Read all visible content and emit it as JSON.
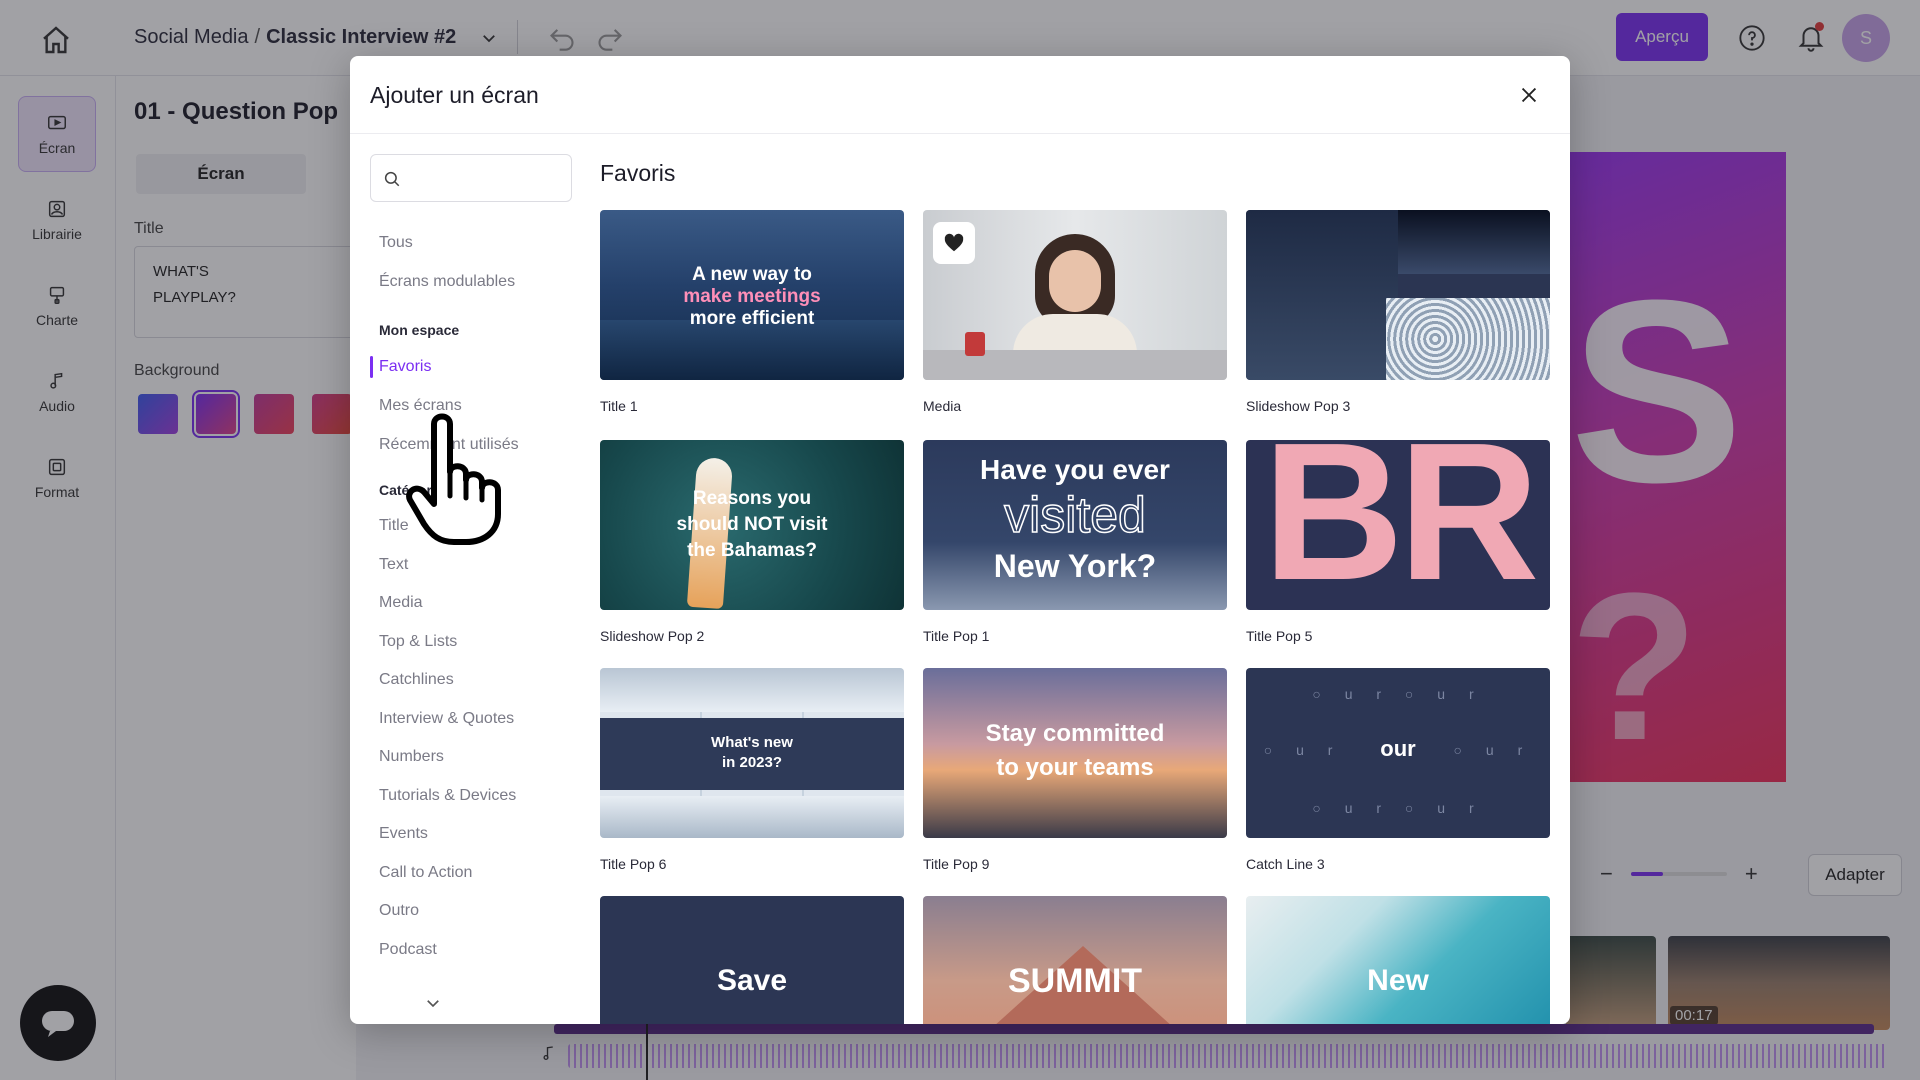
{
  "topbar": {
    "project": "Social Media",
    "separator": "/",
    "video": "Classic Interview #2",
    "preview_label": "Aperçu",
    "avatar_letter": "S"
  },
  "rail": {
    "items": [
      {
        "label": "Écran",
        "icon": "screen-icon"
      },
      {
        "label": "Librairie",
        "icon": "library-icon"
      },
      {
        "label": "Charte",
        "icon": "brand-icon"
      },
      {
        "label": "Audio",
        "icon": "audio-icon"
      },
      {
        "label": "Format",
        "icon": "format-icon"
      }
    ]
  },
  "editor": {
    "title": "01 - Question Pop",
    "tab": "Écran",
    "title_label": "Title",
    "title_value": "WHAT'S\nPLAYPLAY?",
    "background_label": "Background",
    "swatches": [
      "#5b4fe0",
      "#8a3fd8",
      "#d0407a",
      "#e0406a"
    ]
  },
  "canvas": {
    "letter": "S",
    "question": "?"
  },
  "zoom": {
    "minus": "−",
    "plus": "+",
    "level": 0.34,
    "fit_label": "Adapter"
  },
  "timeline": {
    "clip_time": "00:17"
  },
  "modal": {
    "title": "Ajouter un écran",
    "search_placeholder": "",
    "nav": {
      "top": [
        "Tous",
        "Écrans modulables"
      ],
      "my_space_heading": "Mon espace",
      "my_space": [
        "Favoris",
        "Mes écrans",
        "Récemment utilisés"
      ],
      "active": "Favoris",
      "categories_heading": "Catégories",
      "categories": [
        "Title",
        "Text",
        "Media",
        "Top & Lists",
        "Catchlines",
        "Interview & Quotes",
        "Numbers",
        "Tutorials & Devices",
        "Events",
        "Call to Action",
        "Outro",
        "Podcast"
      ]
    },
    "section_title": "Favoris",
    "cards": [
      {
        "label": "Title 1",
        "text_l1": "A new way to",
        "text_l2": "make meetings",
        "text_l3": "more efficient"
      },
      {
        "label": "Media"
      },
      {
        "label": "Slideshow Pop 3"
      },
      {
        "label": "Slideshow Pop 2",
        "text_l1": "Reasons you",
        "text_l2": "should NOT visit",
        "text_l3": "the Bahamas?"
      },
      {
        "label": "Title Pop 1",
        "text_l1": "Have you ever",
        "text_l2": "visited",
        "text_l3": "New York?"
      },
      {
        "label": "Title Pop 5",
        "text_l1": "BR"
      },
      {
        "label": "Title Pop 6",
        "text_l1": "What's new",
        "text_l2": "in 2023?"
      },
      {
        "label": "Title Pop 9",
        "text_l1": "Stay committed",
        "text_l2": "to your teams"
      },
      {
        "label": "Catch Line 3",
        "text_l1": "our"
      },
      {
        "label": "",
        "text_l1": "Save"
      },
      {
        "label": "",
        "text_l1": "SUMMIT"
      },
      {
        "label": "",
        "text_l1": "New"
      }
    ],
    "accent": "#7b2ff2"
  }
}
